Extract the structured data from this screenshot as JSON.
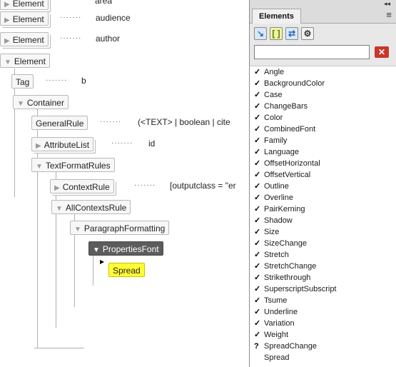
{
  "tree": {
    "nodes": [
      {
        "label": "Element",
        "expanded": false
      },
      {
        "label": "Element",
        "expanded": false
      },
      {
        "label": "Element",
        "expanded": false
      },
      {
        "label": "Element",
        "expanded": true
      },
      {
        "label": "Tag"
      },
      {
        "label": "Container",
        "expanded": true
      },
      {
        "label": "GeneralRule"
      },
      {
        "label": "AttributeList",
        "expanded": false
      },
      {
        "label": "TextFormatRules",
        "expanded": true
      },
      {
        "label": "ContextRule",
        "expanded": false
      },
      {
        "label": "AllContextsRule",
        "expanded": true
      },
      {
        "label": "ParagraphFormatting",
        "expanded": true
      },
      {
        "label": "PropertiesFont",
        "expanded": true
      },
      {
        "label": "Spread"
      }
    ],
    "values": [
      {
        "text": "area"
      },
      {
        "text": "audience"
      },
      {
        "text": "author"
      },
      {
        "text": "b"
      },
      {
        "text": "(<TEXT> | boolean | cite"
      },
      {
        "text": "id"
      },
      {
        "text": "[outputclass = \"er"
      }
    ],
    "expand_glyph": "▼",
    "collapse_glyph": "▶",
    "dots_text": "·······"
  },
  "panel": {
    "tab_label": "Elements",
    "collapse_glyph": "◂◂",
    "menu_glyph": "≡",
    "toolbar": [
      {
        "icon": "insert-element-icon",
        "glyph": "↘",
        "color": "#2a6db8",
        "bg": "#d9e8f7"
      },
      {
        "icon": "wrap-element-icon",
        "glyph": "[ ]",
        "color": "#4a7f1a",
        "bg": "#f2f2a0"
      },
      {
        "icon": "change-element-icon",
        "glyph": "⇄",
        "color": "#1f63b5",
        "bg": "#d9e8f7"
      },
      {
        "icon": "gear-icon",
        "glyph": "⚙",
        "color": "#333333",
        "bg": "#f2f2f2"
      }
    ],
    "search": {
      "value": "",
      "placeholder": ""
    },
    "clear_glyph": "✕",
    "items": [
      {
        "mark": "✓",
        "label": "Angle"
      },
      {
        "mark": "✓",
        "label": "BackgroundColor"
      },
      {
        "mark": "✓",
        "label": "Case"
      },
      {
        "mark": "✓",
        "label": "ChangeBars"
      },
      {
        "mark": "✓",
        "label": "Color"
      },
      {
        "mark": "✓",
        "label": "CombinedFont"
      },
      {
        "mark": "✓",
        "label": "Family"
      },
      {
        "mark": "✓",
        "label": "Language"
      },
      {
        "mark": "✓",
        "label": "OffsetHorizontal"
      },
      {
        "mark": "✓",
        "label": "OffsetVertical"
      },
      {
        "mark": "✓",
        "label": "Outline"
      },
      {
        "mark": "✓",
        "label": "Overline"
      },
      {
        "mark": "✓",
        "label": "PairKerning"
      },
      {
        "mark": "✓",
        "label": "Shadow"
      },
      {
        "mark": "✓",
        "label": "Size"
      },
      {
        "mark": "✓",
        "label": "SizeChange"
      },
      {
        "mark": "✓",
        "label": "Stretch"
      },
      {
        "mark": "✓",
        "label": "StretchChange"
      },
      {
        "mark": "✓",
        "label": "Strikethrough"
      },
      {
        "mark": "✓",
        "label": "SuperscriptSubscript"
      },
      {
        "mark": "✓",
        "label": "Tsume"
      },
      {
        "mark": "✓",
        "label": "Underline"
      },
      {
        "mark": "✓",
        "label": "Variation"
      },
      {
        "mark": "✓",
        "label": "Weight"
      },
      {
        "mark": "?",
        "label": "SpreadChange"
      },
      {
        "mark": "",
        "label": "Spread"
      }
    ]
  },
  "colors": {
    "selected_node": "#5c5c5c",
    "highlight_node": "#ffff33",
    "clear_button": "#c9362b"
  }
}
